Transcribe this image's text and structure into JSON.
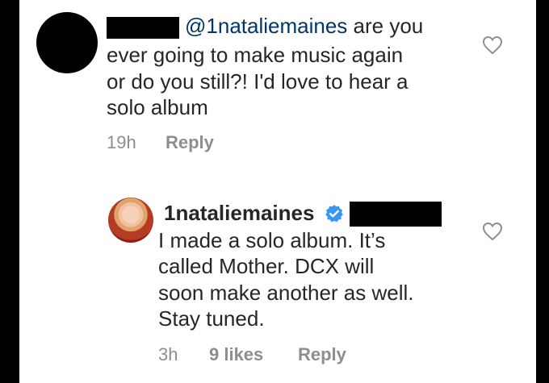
{
  "comment1": {
    "mention": "@1nataliemaines",
    "lines": [
      " are you",
      "ever going to make music again",
      "or do you still?! I'd love to hear a",
      "solo album"
    ],
    "time": "19h",
    "reply_label": "Reply"
  },
  "comment2": {
    "username": "1nataliemaines",
    "lines": [
      "I made a solo album. It’s",
      "called Mother. DCX will",
      "soon make another as well.",
      "Stay tuned."
    ],
    "time": "3h",
    "likes": "9 likes",
    "reply_label": "Reply"
  },
  "icons": {
    "like": "heart-outline-icon",
    "verified": "verified-badge-icon"
  },
  "colors": {
    "text": "#262626",
    "mention": "#00376b",
    "secondary": "#8e8e8e",
    "verified": "#3897f0"
  }
}
